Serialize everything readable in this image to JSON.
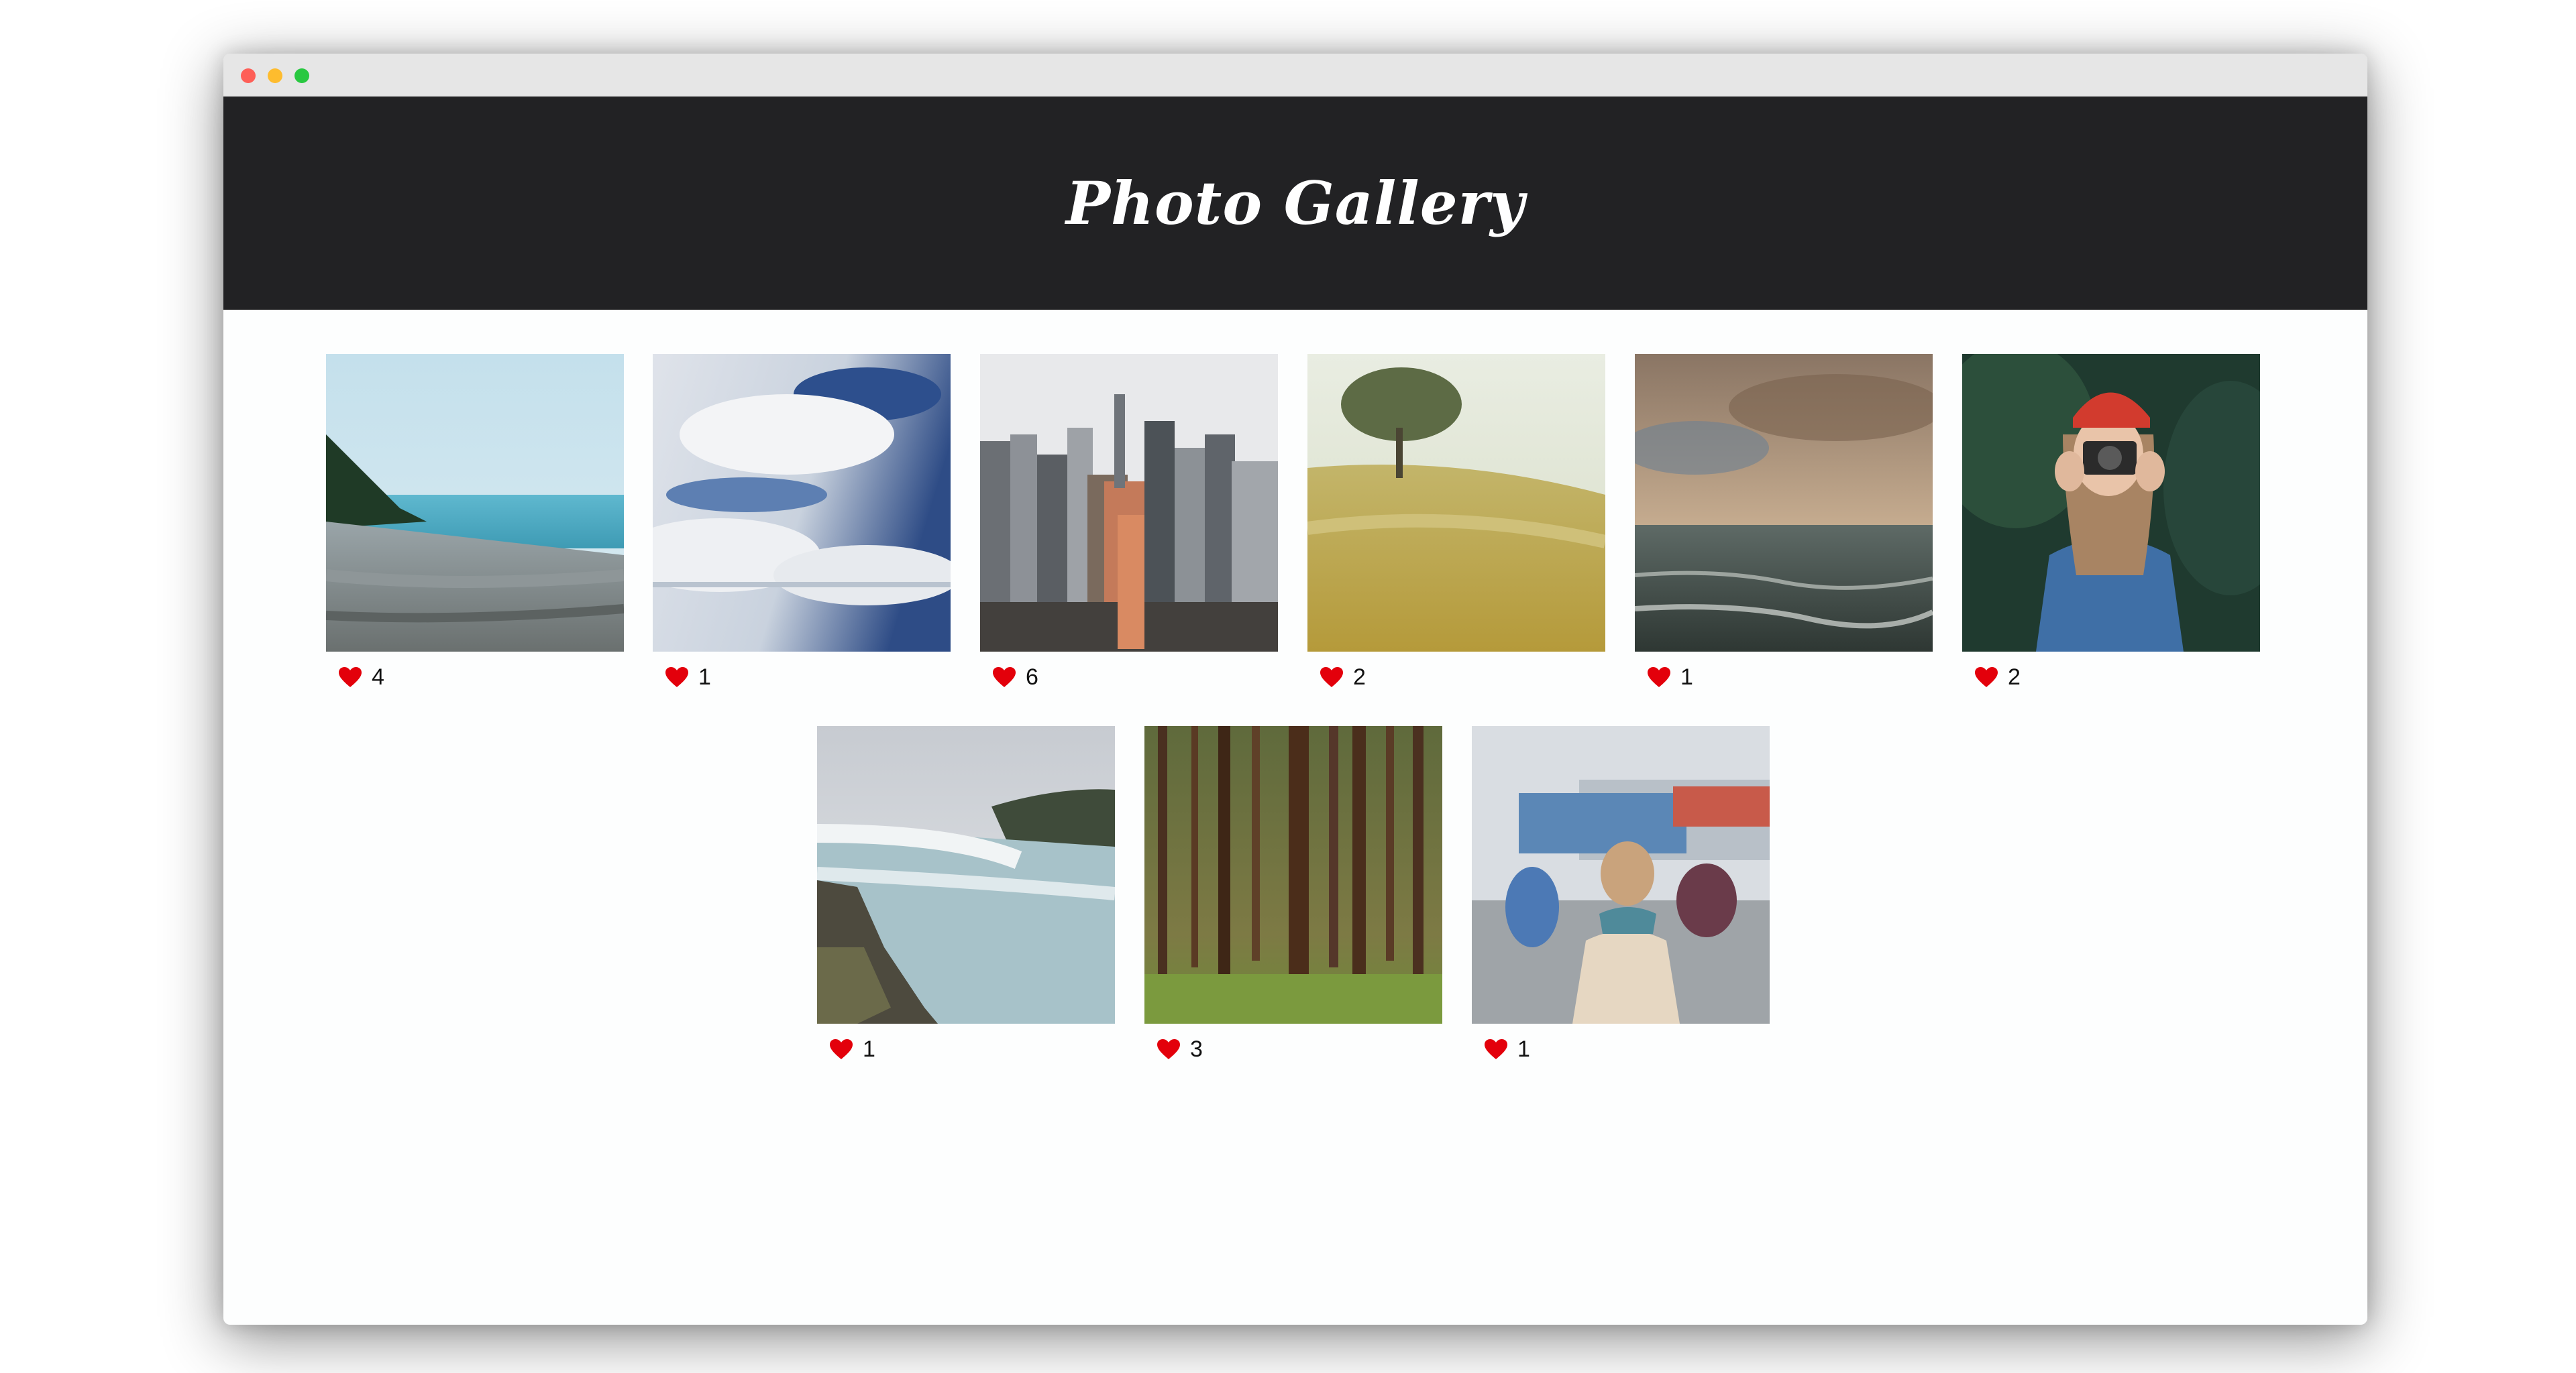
{
  "window": {
    "controls": [
      "close-button",
      "minimize-button",
      "zoom-button"
    ],
    "colors": {
      "close": "#fe5f57",
      "minimize": "#febc2e",
      "zoom": "#28c840"
    }
  },
  "header": {
    "title": "Photo Gallery",
    "background": "#222224"
  },
  "gallery": {
    "like_icon": "heart-icon",
    "like_color": "#e3000b",
    "photos": [
      {
        "subject": "beach",
        "likes": "4"
      },
      {
        "subject": "clouds",
        "likes": "1"
      },
      {
        "subject": "city-skyline",
        "likes": "6"
      },
      {
        "subject": "field-tree",
        "likes": "2"
      },
      {
        "subject": "ocean-sunset",
        "likes": "1"
      },
      {
        "subject": "woman-camera",
        "likes": "2"
      },
      {
        "subject": "waterfall",
        "likes": "1"
      },
      {
        "subject": "forest",
        "likes": "3"
      },
      {
        "subject": "street-traveler",
        "likes": "1"
      }
    ]
  }
}
